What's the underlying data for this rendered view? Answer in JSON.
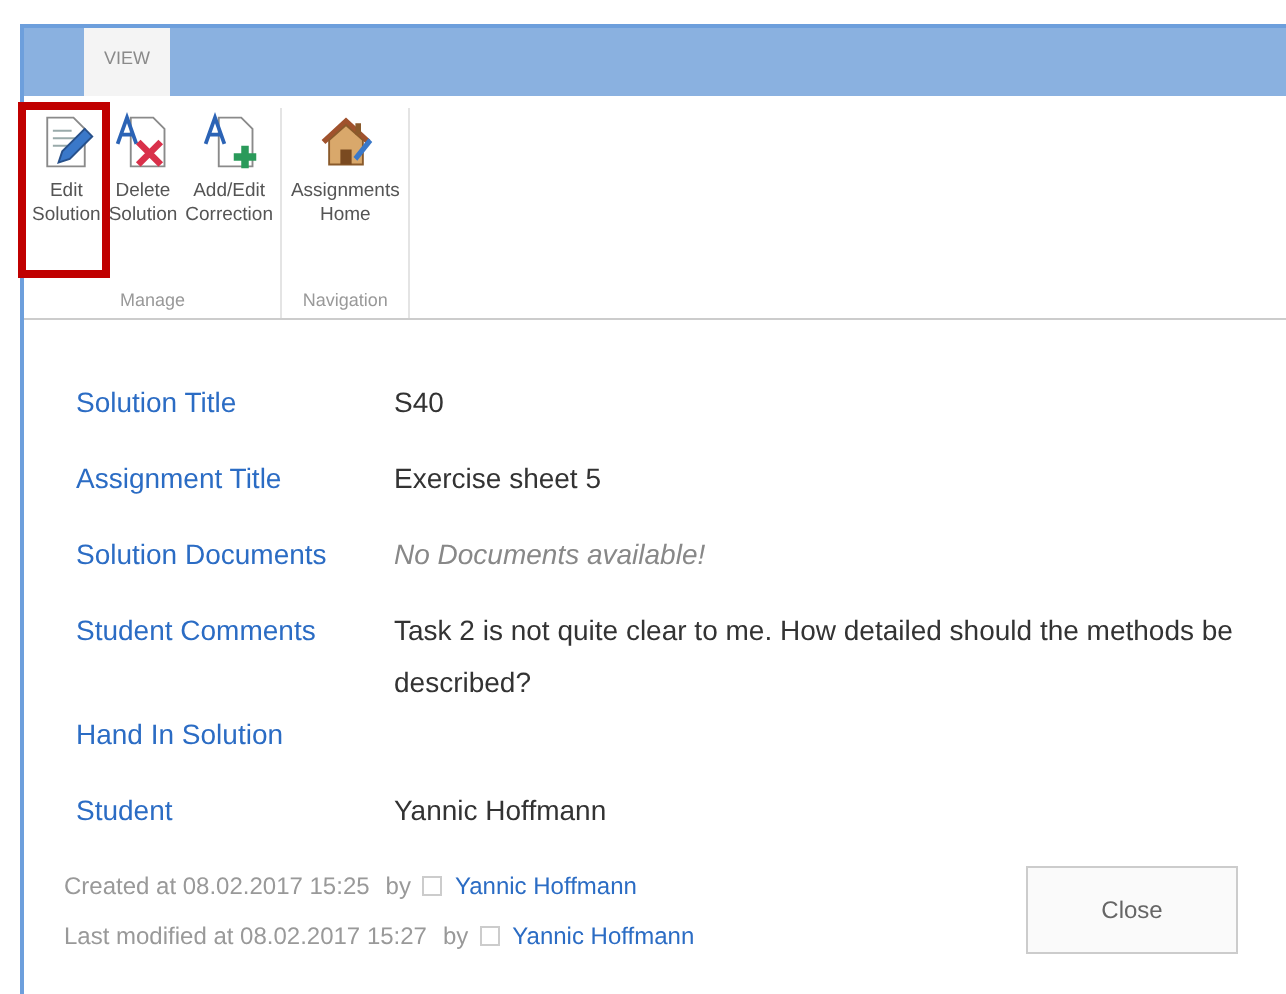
{
  "tabs": [
    {
      "label": "VIEW",
      "selected": true
    }
  ],
  "ribbon": {
    "groups": [
      {
        "label": "Manage",
        "buttons": [
          {
            "label": "Edit Solution",
            "kind": "edit",
            "highlighted": true
          },
          {
            "label": "Delete Solution",
            "kind": "delete",
            "highlighted": false
          },
          {
            "label": "Add/Edit Correction",
            "kind": "add",
            "highlighted": false
          }
        ]
      },
      {
        "label": "Navigation",
        "buttons": [
          {
            "label": "Assignments Home",
            "kind": "home",
            "highlighted": false
          }
        ]
      }
    ]
  },
  "fields": [
    {
      "label": "Solution Title",
      "value": "S40",
      "kind": "text"
    },
    {
      "label": "Assignment Title",
      "value": "Exercise sheet 5",
      "kind": "text"
    },
    {
      "label": "Solution Documents",
      "value": "No Documents available!",
      "kind": "empty"
    },
    {
      "label": "Student Comments",
      "value": "Task 2 is not quite clear to me. How detailed should the methods be described?",
      "kind": "text"
    },
    {
      "label": "Hand In Solution"
    },
    {
      "label": "Student",
      "value": "Yannic Hoffmann",
      "kind": "text"
    }
  ],
  "footer": [
    {
      "text": "Created at 08.02.2017 15:25",
      "by": "by",
      "user": "Yannic Hoffmann"
    },
    {
      "text": "Last modified at 08.02.2017 15:27",
      "by": "by",
      "user": "Yannic Hoffmann"
    }
  ],
  "close_button": "Close"
}
